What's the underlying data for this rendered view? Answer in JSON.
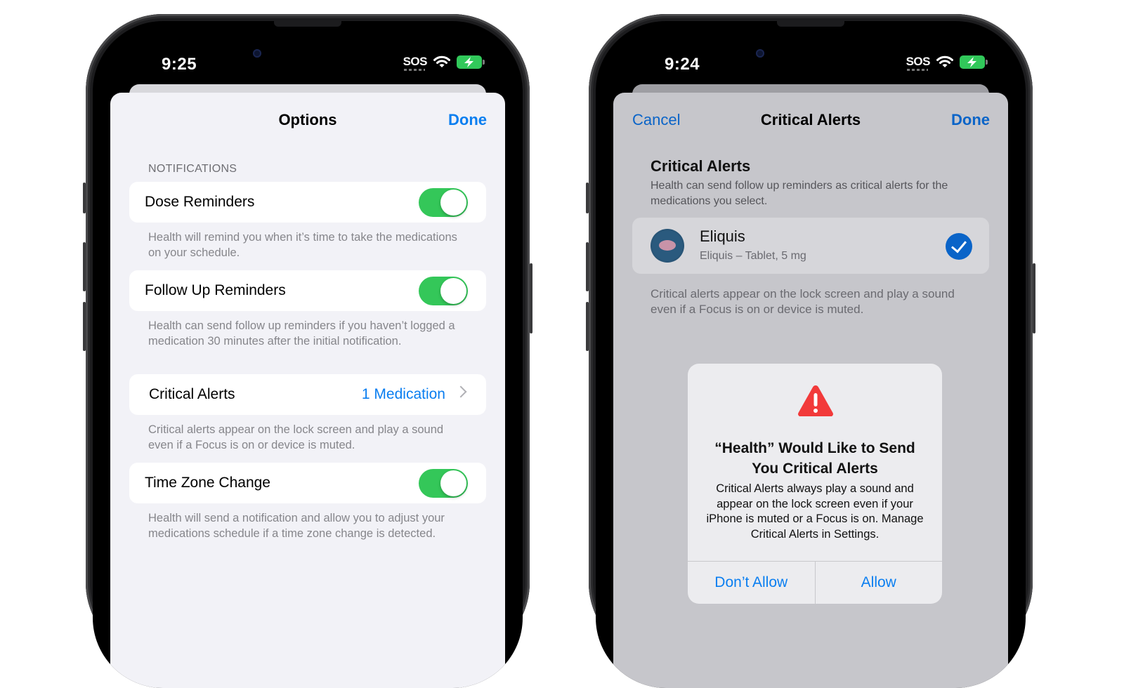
{
  "left_phone": {
    "status": {
      "time": "9:25",
      "sos": "SOS"
    },
    "nav": {
      "title": "Options",
      "done": "Done"
    },
    "section_header": "NOTIFICATIONS",
    "rows": {
      "dose": {
        "label": "Dose Reminders",
        "toggle_on": true,
        "footer": "Health will remind you when it’s time to take the medications on your schedule."
      },
      "followup": {
        "label": "Follow Up Reminders",
        "toggle_on": true,
        "footer": "Health can send follow up reminders if you haven’t logged a medication 30 minutes after the initial notification."
      },
      "critical": {
        "label": "Critical Alerts",
        "value": "1 Medication",
        "footer": "Critical alerts appear on the lock screen and play a sound even if a Focus is on or device is muted."
      },
      "timezone": {
        "label": "Time Zone Change",
        "toggle_on": true,
        "footer": "Health will send a notification and allow you to adjust your medications schedule if a time zone change is detected."
      }
    }
  },
  "right_phone": {
    "status": {
      "time": "9:24",
      "sos": "SOS"
    },
    "nav": {
      "cancel": "Cancel",
      "title": "Critical Alerts",
      "done": "Done"
    },
    "heading": "Critical Alerts",
    "subtitle": "Health can send follow up reminders as critical alerts for the medications you select.",
    "medication": {
      "name": "Eliquis",
      "detail": "Eliquis – Tablet, 5 mg",
      "selected": true
    },
    "footer": "Critical alerts appear on the lock screen and play a sound even if a Focus is on or device is muted.",
    "alert": {
      "title": "“Health” Would Like to Send You Critical Alerts",
      "message": "Critical Alerts always play a sound and appear on the lock screen even if your iPhone is muted or a Focus is on. Manage Critical Alerts in Settings.",
      "dont_allow": "Don’t Allow",
      "allow": "Allow"
    }
  },
  "colors": {
    "accent": "#0a7ef0",
    "toggle_on": "#34c759",
    "warning": "#f23a3a"
  }
}
